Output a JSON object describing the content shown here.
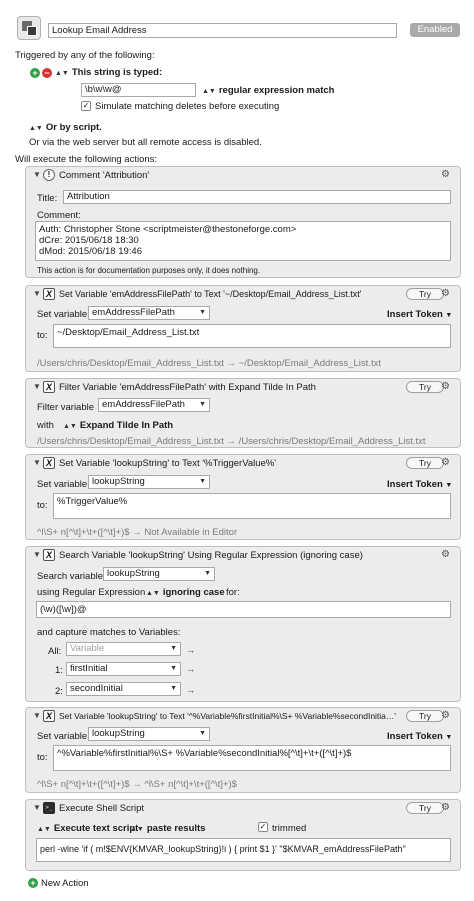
{
  "macro": {
    "name": "Lookup Email Address",
    "enabled_label": "Enabled"
  },
  "triggers": {
    "heading": "Triggered by any of the following:",
    "string_trigger_label": "This string is typed:",
    "string_value": "\\b\\w\\w@",
    "match_mode": "regular expression match",
    "simulate_label": "Simulate matching deletes before executing",
    "script_label": "Or by script.",
    "web_note": "Or via the web server but all remote access is disabled."
  },
  "actions_heading": "Will execute the following actions:",
  "actions": {
    "comment": {
      "title": "Comment 'Attribution'",
      "title_label": "Title:",
      "title_value": "Attribution",
      "comment_label": "Comment:",
      "lines": [
        "Auth:  Christopher Stone <scriptmeister@thestoneforge.com>",
        "dCre:  2015/06/18 18:30",
        "dMod:  2015/06/18 19:46"
      ],
      "note": "This action is for documentation purposes only, it does nothing."
    },
    "setvar1": {
      "title": "Set Variable 'emAddressFilePath' to Text '~/Desktop/Email_Address_List.txt'",
      "try": "Try",
      "set_label": "Set variable",
      "var": "emAddressFilePath",
      "insert": "Insert Token",
      "to_label": "to:",
      "to_value": "~/Desktop/Email_Address_List.txt",
      "preview": "/Users/chris/Desktop/Email_Address_List.txt → ~/Desktop/Email_Address_List.txt"
    },
    "filter": {
      "title": "Filter Variable 'emAddressFilePath' with Expand Tilde In Path",
      "try": "Try",
      "var_label": "Filter variable",
      "var": "emAddressFilePath",
      "with_label": "with",
      "with_value": "Expand Tilde In Path",
      "preview": "/Users/chris/Desktop/Email_Address_List.txt → /Users/chris/Desktop/Email_Address_List.txt"
    },
    "setvar2": {
      "title": "Set Variable 'lookupString' to Text '%TriggerValue%'",
      "try": "Try",
      "set_label": "Set variable",
      "var": "lookupString",
      "insert": "Insert Token",
      "to_label": "to:",
      "to_value": "%TriggerValue%",
      "preview": "^l\\S+ n[^\\t]+\\t+([^\\t]+)$ → Not Available in Editor"
    },
    "search": {
      "title": "Search Variable 'lookupString' Using Regular Expression (ignoring case)",
      "search_label": "Search variable",
      "var": "lookupString",
      "using_label": "using Regular Expression",
      "case": "ignoring case",
      "for_label": "for:",
      "regex": "(\\w)([\\w])@",
      "capture_label": "and capture matches to Variables:",
      "all_label": "All:",
      "all_placeholder": "Variable",
      "one_label": "1:",
      "one_value": "firstInitial",
      "two_label": "2:",
      "two_value": "secondInitial"
    },
    "setvar3": {
      "title": "Set Variable 'lookupString' to Text '^%Variable%firstInitial%\\S+ %Variable%secondInitia…'",
      "try": "Try",
      "set_label": "Set variable",
      "var": "lookupString",
      "insert": "Insert Token",
      "to_label": "to:",
      "to_value": "^%Variable%firstInitial%\\S+ %Variable%secondInitial%[^\\t]+\\t+([^\\t]+)$",
      "preview": "^l\\S+ n[^\\t]+\\t+([^\\t]+)$ → ^l\\S+ n[^\\t]+\\t+([^\\t]+)$"
    },
    "shell": {
      "title": "Execute Shell Script",
      "try": "Try",
      "mode": "Execute text script",
      "output": "paste results",
      "trimmed": "trimmed",
      "script": "perl -wlne 'if ( m!$ENV{KMVAR_lookupString}!i ) { print $1 }' \"$KMVAR_emAddressFilePath\""
    }
  },
  "new_action": "New Action",
  "colors": {
    "add_green": "#2ea043",
    "remove_red": "#d9342b",
    "panel_bg": "#ececec",
    "enabled_bg": "#a9a9a9"
  }
}
